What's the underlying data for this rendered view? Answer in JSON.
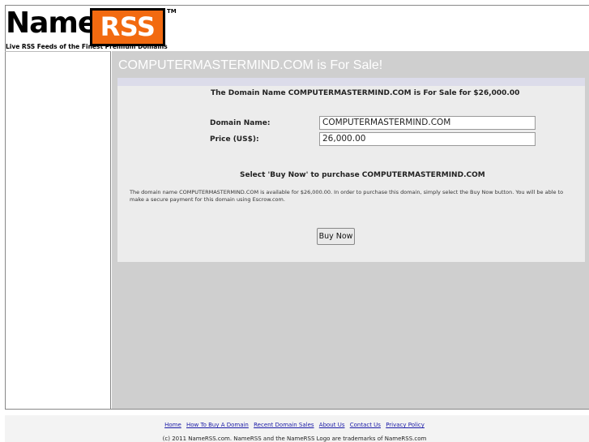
{
  "logo": {
    "name": "Name",
    "rss": "RSS",
    "tm": "TM"
  },
  "tagline": "Live RSS Feeds of the Finest Premium Domains",
  "main": {
    "title": "COMPUTERMASTERMIND.COM is For Sale!",
    "headline": "The Domain Name COMPUTERMASTERMIND.COM is For Sale for $26,000.00",
    "domain_label": "Domain Name:",
    "domain_value": "COMPUTERMASTERMIND.COM",
    "price_label": "Price (US$):",
    "price_value": "26,000.00",
    "instruction": "Select 'Buy Now' to purchase COMPUTERMASTERMIND.COM",
    "description": "The domain name COMPUTERMASTERMIND.COM is available for $26,000.00. In order to purchase this domain, simply select the Buy Now button. You will be able to make a secure payment for this domain using Escrow.com.",
    "buy_button": "Buy Now"
  },
  "footer": {
    "links": [
      "Home",
      "How To Buy A Domain",
      "Recent Domain Sales",
      "About Us",
      "Contact Us",
      "Privacy Policy"
    ],
    "copyright": "(c) 2011 NameRSS.com. NameRSS and the NameRSS Logo are trademarks of NameRSS.com"
  },
  "colors": {
    "brand_orange": "#f26a10",
    "panel_gray": "#cfcfcf",
    "link_blue": "#1a1aa6"
  }
}
